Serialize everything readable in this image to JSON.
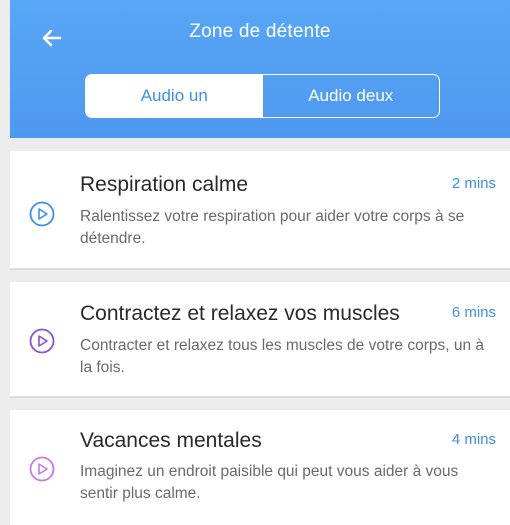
{
  "header": {
    "title": "Zone de détente",
    "tabs": [
      {
        "label": "Audio un",
        "active": true
      },
      {
        "label": "Audio deux",
        "active": false
      }
    ]
  },
  "exercises": [
    {
      "title": "Respiration calme",
      "duration": "2 mins",
      "description": "Ralentissez votre respiration pour aider votre corps à se détendre.",
      "icon": "play-circle-icon",
      "icon_color": "#3e8fe8"
    },
    {
      "title": "Contractez et relaxez vos muscles",
      "duration": "6 mins",
      "description": "Contracter et relaxez tous les muscles de votre corps, un à la fois.",
      "icon": "play-circle-icon",
      "icon_color": "#8e4fd6"
    },
    {
      "title": "Vacances mentales",
      "duration": "4 mins",
      "description": "Imaginez un endroit paisible qui peut vous aider à vous sentir plus calme.",
      "icon": "play-circle-icon",
      "icon_color": "#c77ae0"
    }
  ],
  "colors": {
    "header": "#4e99f0",
    "accent": "#3e8fe8",
    "background": "#ececec"
  }
}
